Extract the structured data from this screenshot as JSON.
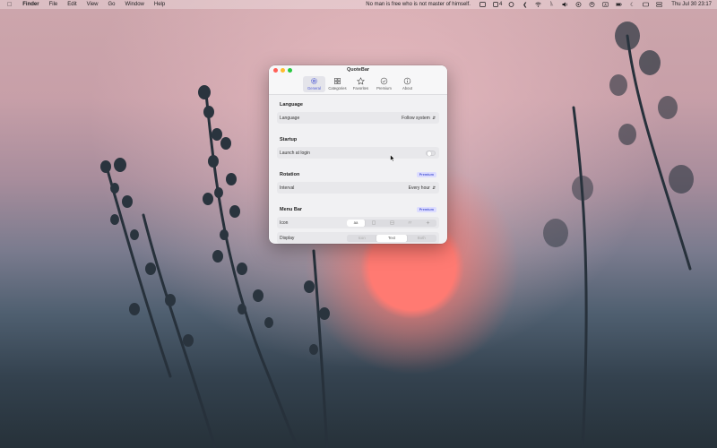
{
  "menubar": {
    "app": "Finder",
    "menus": [
      "File",
      "Edit",
      "View",
      "Go",
      "Window",
      "Help"
    ],
    "quote": "No man is free who is not master of himself.",
    "notification_count": "4",
    "clock": "Thu Jul 30  23:17",
    "status_icons": [
      "box-icon",
      "notification-icon",
      "cloud-icon",
      "shortcut-icon",
      "wifi-icon",
      "bluetooth-icon",
      "volume-icon",
      "play-icon",
      "user-icon",
      "text-input-icon",
      "battery-icon",
      "moon-icon",
      "keyboard-icon",
      "control-center-icon"
    ]
  },
  "window": {
    "title": "QuoteBar",
    "tabs": [
      {
        "label": "General",
        "icon": "gear-icon",
        "active": true
      },
      {
        "label": "Categories",
        "icon": "grid-icon",
        "active": false
      },
      {
        "label": "Favorites",
        "icon": "star-icon",
        "active": false
      },
      {
        "label": "Premium",
        "icon": "check-circle-icon",
        "active": false
      },
      {
        "label": "About",
        "icon": "info-icon",
        "active": false
      }
    ]
  },
  "sections": {
    "language": {
      "title": "Language",
      "row_label": "Language",
      "value": "Follow system"
    },
    "startup": {
      "title": "Startup",
      "row_label": "Launch at login",
      "toggle_on": false
    },
    "rotation": {
      "title": "Rotation",
      "badge": "Premium",
      "row_label": "Interval",
      "value": "Every hour"
    },
    "menubar": {
      "title": "Menu Bar",
      "badge": "Premium",
      "icon_label": "Icon",
      "icon_options": [
        "aa",
        "doc",
        "layers",
        "quote",
        "sparkle"
      ],
      "icon_selected": 0,
      "display_label": "Display",
      "display_options": [
        "Icon",
        "Text",
        "Both"
      ],
      "display_selected": 1
    }
  },
  "colors": {
    "accent": "#4f5bd5",
    "close": "#ff5f57",
    "minimize": "#febc2e",
    "zoom": "#28c840"
  }
}
